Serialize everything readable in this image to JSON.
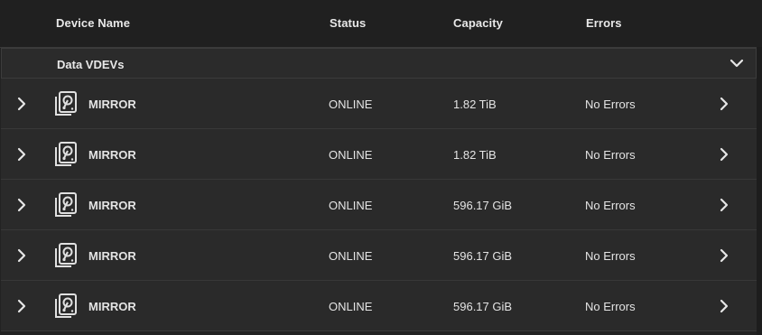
{
  "header": {
    "device_name": "Device Name",
    "status": "Status",
    "capacity": "Capacity",
    "errors": "Errors"
  },
  "group": {
    "label": "Data VDEVs",
    "toggle_icon": "chevron-down-icon"
  },
  "rows": [
    {
      "name": "MIRROR",
      "status": "ONLINE",
      "capacity": "1.82 TiB",
      "errors": "No Errors"
    },
    {
      "name": "MIRROR",
      "status": "ONLINE",
      "capacity": "1.82 TiB",
      "errors": "No Errors"
    },
    {
      "name": "MIRROR",
      "status": "ONLINE",
      "capacity": "596.17 GiB",
      "errors": "No Errors"
    },
    {
      "name": "MIRROR",
      "status": "ONLINE",
      "capacity": "596.17 GiB",
      "errors": "No Errors"
    },
    {
      "name": "MIRROR",
      "status": "ONLINE",
      "capacity": "596.17 GiB",
      "errors": "No Errors"
    }
  ],
  "icons": {
    "row_expand": "chevron-right-icon",
    "device": "harddisk-mirror-icon",
    "row_open": "chevron-right-icon"
  },
  "colors": {
    "background": "#222222",
    "row": "#2a2a2a",
    "text": "#e4e4e4",
    "icon": "#e0e0e0"
  }
}
